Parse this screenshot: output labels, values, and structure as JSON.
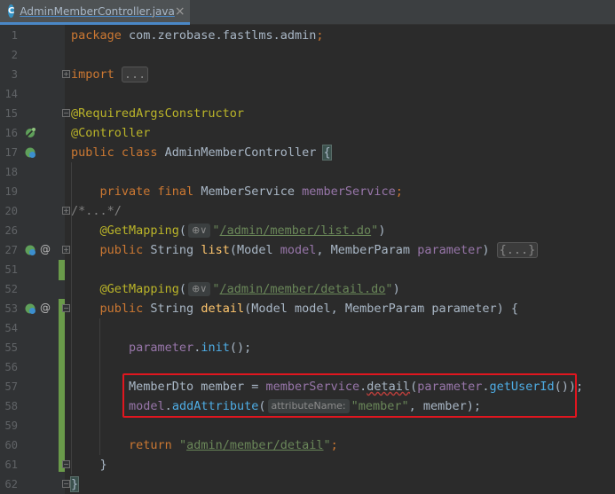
{
  "tab": {
    "icon_letter": "C",
    "filename": "AdminMemberController.java",
    "close": "×"
  },
  "lines": [
    {
      "num": "1",
      "segments": [
        [
          "kw",
          "package "
        ],
        [
          "",
          "com.zerobase.fastlms.admin"
        ],
        [
          "kw",
          ";"
        ]
      ]
    },
    {
      "num": "2",
      "segments": []
    },
    {
      "num": "3",
      "segments": [
        [
          "kw",
          "import "
        ],
        [
          "fold-txt",
          "..."
        ]
      ]
    },
    {
      "num": "14",
      "segments": []
    },
    {
      "num": "15",
      "segments": [
        [
          "an",
          "@RequiredArgsConstructor"
        ]
      ]
    },
    {
      "num": "16",
      "segments": [
        [
          "an",
          "@Controller"
        ]
      ]
    },
    {
      "num": "17",
      "segments": [
        [
          "kw",
          "public class "
        ],
        [
          "",
          "AdminMemberController "
        ],
        [
          "brace-hl",
          "{"
        ]
      ]
    },
    {
      "num": "18",
      "segments": []
    },
    {
      "num": "19",
      "segments": [
        [
          "",
          "    "
        ],
        [
          "kw",
          "private final "
        ],
        [
          "",
          "MemberService "
        ],
        [
          "fld",
          "memberService"
        ],
        [
          "kw",
          ";"
        ]
      ]
    },
    {
      "num": "20",
      "segments": [
        [
          "cm",
          "/*...*/"
        ]
      ]
    },
    {
      "num": "26",
      "segments": [
        [
          "",
          "    "
        ],
        [
          "an",
          "@GetMapping"
        ],
        [
          "",
          "("
        ],
        [
          "hint",
          "⊕∨"
        ],
        [
          "st",
          "\""
        ],
        [
          "stu",
          "/admin/member/list.do"
        ],
        [
          "st",
          "\""
        ],
        [
          "",
          ")"
        ]
      ]
    },
    {
      "num": "27",
      "segments": [
        [
          "",
          "    "
        ],
        [
          "kw",
          "public "
        ],
        [
          "",
          "String "
        ],
        [
          "mth",
          "list"
        ],
        [
          "",
          "(Model "
        ],
        [
          "fld2",
          "model"
        ],
        [
          "",
          ", MemberParam "
        ],
        [
          "fld2",
          "parameter"
        ],
        [
          "",
          ") "
        ],
        [
          "fold-txt",
          "{...}"
        ]
      ]
    },
    {
      "num": "51",
      "segments": []
    },
    {
      "num": "52",
      "segments": [
        [
          "",
          "    "
        ],
        [
          "an",
          "@GetMapping"
        ],
        [
          "",
          "("
        ],
        [
          "hint",
          "⊕∨"
        ],
        [
          "st",
          "\""
        ],
        [
          "stu",
          "/admin/member/detail.do"
        ],
        [
          "st",
          "\""
        ],
        [
          "",
          ")"
        ]
      ]
    },
    {
      "num": "53",
      "segments": [
        [
          "",
          "    "
        ],
        [
          "kw",
          "public "
        ],
        [
          "",
          "String "
        ],
        [
          "mth",
          "detail"
        ],
        [
          "",
          "(Model model, MemberParam parameter) {"
        ]
      ]
    },
    {
      "num": "54",
      "segments": []
    },
    {
      "num": "55",
      "segments": [
        [
          "",
          "        "
        ],
        [
          "fld2",
          "parameter"
        ],
        [
          "",
          "."
        ],
        [
          "call",
          "init"
        ],
        [
          "",
          "();"
        ]
      ]
    },
    {
      "num": "56",
      "segments": []
    },
    {
      "num": "57",
      "segments": [
        [
          "",
          "        "
        ],
        [
          "",
          "MemberDto member = "
        ],
        [
          "fld",
          "memberService"
        ],
        [
          "",
          "."
        ],
        [
          "squiggle",
          "detail"
        ],
        [
          "",
          "("
        ],
        [
          "fld2",
          "parameter"
        ],
        [
          "",
          "."
        ],
        [
          "call",
          "getUserId"
        ],
        [
          "",
          "());"
        ]
      ]
    },
    {
      "num": "58",
      "segments": [
        [
          "",
          "        "
        ],
        [
          "fld2",
          "model"
        ],
        [
          "",
          "."
        ],
        [
          "call",
          "addAttribute"
        ],
        [
          "",
          "("
        ],
        [
          "hint",
          "attributeName:"
        ],
        [
          "st",
          "\"member\""
        ],
        [
          "",
          ", member);"
        ]
      ]
    },
    {
      "num": "59",
      "segments": []
    },
    {
      "num": "60",
      "segments": [
        [
          "",
          "        "
        ],
        [
          "kw",
          "return "
        ],
        [
          "st",
          "\""
        ],
        [
          "stu",
          "admin/member/detail"
        ],
        [
          "st",
          "\""
        ],
        [
          "kw",
          ";"
        ]
      ]
    },
    {
      "num": "61",
      "segments": [
        [
          "",
          "    }"
        ]
      ]
    },
    {
      "num": "62",
      "segments": [
        [
          "brace-hl",
          "}"
        ]
      ]
    }
  ],
  "colors": {
    "accent": "#4a88c7",
    "highlight_box": "#e0161f",
    "change_bar": "#6a9b4a"
  },
  "gutter_icons": {
    "line16": "bean-icon",
    "line17": "bean-run-icon",
    "line27": "bean-run-icon",
    "line53": "bean-run-icon",
    "at_symbol": "@"
  }
}
